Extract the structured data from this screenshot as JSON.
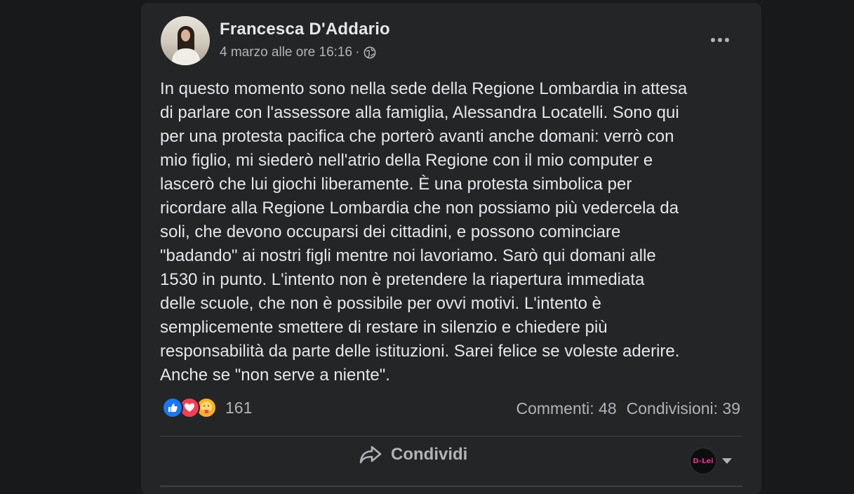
{
  "post": {
    "author": "Francesca D'Addario",
    "date": "4 marzo alle ore 16:16",
    "separator": "·",
    "privacy_icon": "globe-icon",
    "text": "In questo momento sono nella sede della Regione Lombardia in attesa\ndi parlare con l'assessore alla famiglia, Alessandra Locatelli. Sono qui\nper una protesta pacifica che porterò avanti anche domani: verrò con\nmio figlio, mi siederò nell'atrio della Regione con il mio computer e\nlascerò che lui giochi liberamente. È una protesta simbolica per\nricordare alla Regione Lombardia che non possiamo più vedercela da\nsoli, che devono occuparsi dei cittadini, e possono cominciare\n\"badando\" ai nostri figli mentre noi lavoriamo. Sarò qui domani alle\n1530 in punto. L'intento non è pretendere la riapertura immediata\ndelle scuole, che non è possibile per ovvi motivi. L'intento è\nsemplicemente smettere di restare in silenzio e chiedere più\nresponsabilità da parte delle istituzioni. Sarei felice se voleste aderire.\nAnche se \"non serve a niente\"."
  },
  "engagement": {
    "reactions": [
      "like-icon",
      "love-icon",
      "care-icon"
    ],
    "reaction_count": "161",
    "comments": "Commenti: 48",
    "shares": "Condivisioni: 39"
  },
  "actions": {
    "share_label": "Condividi",
    "profile_switch_label": "D-Lei"
  },
  "colors": {
    "background": "#18191a",
    "card": "#242526",
    "primary_text": "#e4e6eb",
    "secondary_text": "#b0b3b8",
    "like": "#1877f2",
    "love": "#f33e58",
    "care": "#f7b125"
  }
}
